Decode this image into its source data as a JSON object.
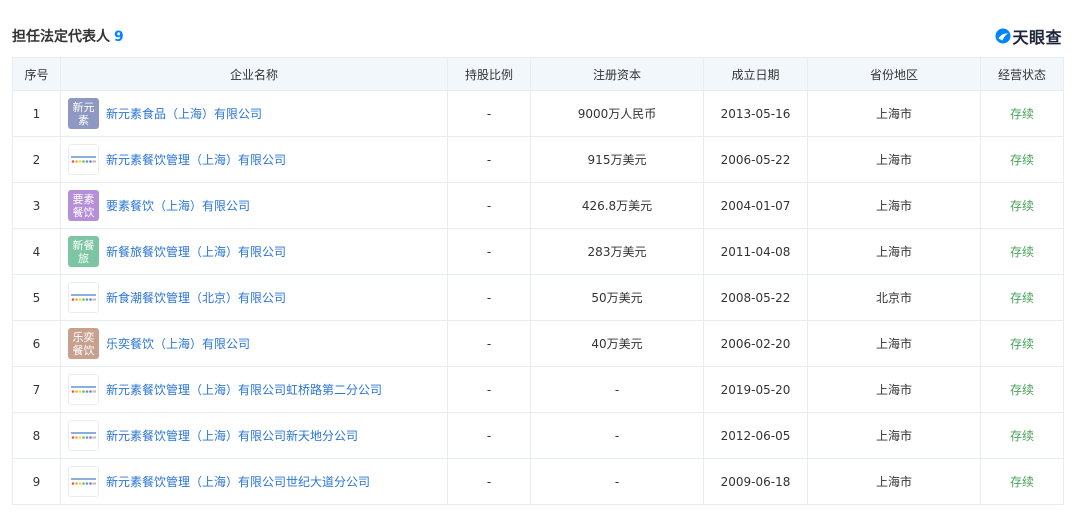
{
  "header": {
    "title": "担任法定代表人",
    "count": "9",
    "brand_text": "天眼查"
  },
  "colors": {
    "accent": "#0084ff",
    "link": "#2a75d8",
    "status_active": "#48a259",
    "header_bg": "#f2f7fc"
  },
  "table": {
    "columns": [
      "序号",
      "企业名称",
      "持股比例",
      "注册资本",
      "成立日期",
      "省份地区",
      "经营状态"
    ],
    "rows": [
      {
        "no": "1",
        "logo_text": "新元素",
        "logo_color": "#8e98c2",
        "name": "新元素食品（上海）有限公司",
        "share": "-",
        "capital": "9000万人民币",
        "date": "2013-05-16",
        "region": "上海市",
        "status": "存续"
      },
      {
        "no": "2",
        "logo_text": "",
        "logo_color": "",
        "name": "新元素餐饮管理（上海）有限公司",
        "share": "-",
        "capital": "915万美元",
        "date": "2006-05-22",
        "region": "上海市",
        "status": "存续"
      },
      {
        "no": "3",
        "logo_text": "要素餐饮",
        "logo_color": "#b58fd8",
        "name": "要素餐饮（上海）有限公司",
        "share": "-",
        "capital": "426.8万美元",
        "date": "2004-01-07",
        "region": "上海市",
        "status": "存续"
      },
      {
        "no": "4",
        "logo_text": "新餐旅",
        "logo_color": "#7cc6a3",
        "name": "新餐旅餐饮管理（上海）有限公司",
        "share": "-",
        "capital": "283万美元",
        "date": "2011-04-08",
        "region": "上海市",
        "status": "存续"
      },
      {
        "no": "5",
        "logo_text": "",
        "logo_color": "",
        "name": "新食潮餐饮管理（北京）有限公司",
        "share": "-",
        "capital": "50万美元",
        "date": "2008-05-22",
        "region": "北京市",
        "status": "存续"
      },
      {
        "no": "6",
        "logo_text": "乐奕餐饮",
        "logo_color": "#c8a08e",
        "name": "乐奕餐饮（上海）有限公司",
        "share": "-",
        "capital": "40万美元",
        "date": "2006-02-20",
        "region": "上海市",
        "status": "存续"
      },
      {
        "no": "7",
        "logo_text": "",
        "logo_color": "",
        "name": "新元素餐饮管理（上海）有限公司虹桥路第二分公司",
        "share": "-",
        "capital": "-",
        "date": "2019-05-20",
        "region": "上海市",
        "status": "存续"
      },
      {
        "no": "8",
        "logo_text": "",
        "logo_color": "",
        "name": "新元素餐饮管理（上海）有限公司新天地分公司",
        "share": "-",
        "capital": "-",
        "date": "2012-06-05",
        "region": "上海市",
        "status": "存续"
      },
      {
        "no": "9",
        "logo_text": "",
        "logo_color": "",
        "name": "新元素餐饮管理（上海）有限公司世纪大道分公司",
        "share": "-",
        "capital": "-",
        "date": "2009-06-18",
        "region": "上海市",
        "status": "存续"
      }
    ]
  }
}
